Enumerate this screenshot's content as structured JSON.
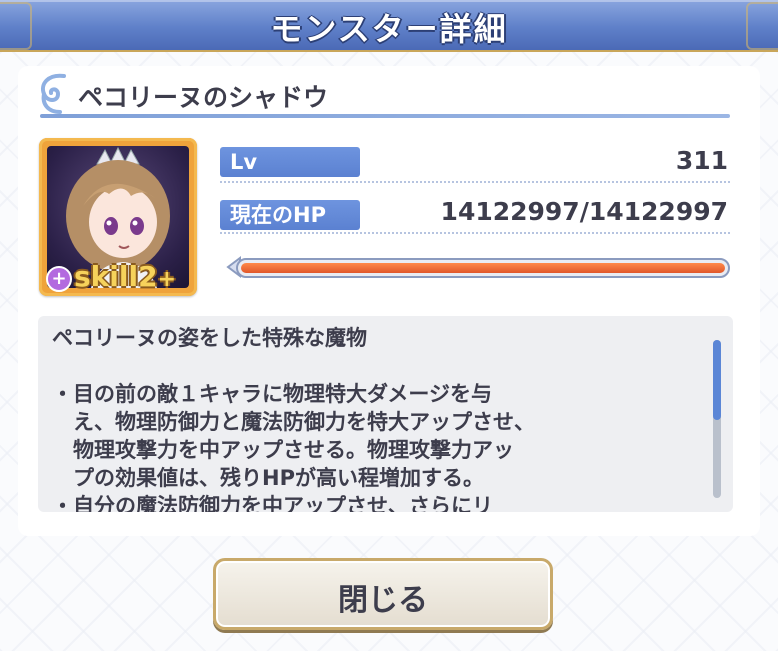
{
  "dialog": {
    "title": "モンスター詳細",
    "close_label": "閉じる"
  },
  "monster": {
    "name": "ペコリーヌのシャドウ",
    "skill_badge": "skill2",
    "skill_plus_symbol": "+",
    "level_label": "Lv",
    "level_value": "311",
    "hp_label": "現在のHP",
    "hp_value": "14122997/14122997",
    "hp_fraction": 1.0
  },
  "description": {
    "text": "ペコリーヌの姿をした特殊な魔物\n\n・目の前の敵１キャラに物理特大ダメージを与\n　え、物理防御力と魔法防御力を特大アップさせ、\n　物理攻撃力を中アップさせる。物理攻撃力アッ\n　プの効果値は、残りHPが高い程増加する。\n・自分の魔法防御力を中アップさせ、さらにリ"
  },
  "colors": {
    "title_bar": "#5f80c9",
    "accent_blue": "#5b81d1",
    "hp_fill": "#e0572a",
    "portrait_frame": "#efa33b"
  },
  "icons": {
    "name_ornament": "swirl-ornament-icon",
    "hp_bar_cap": "arrow-cap-icon",
    "skill_plus": "plus-icon"
  }
}
